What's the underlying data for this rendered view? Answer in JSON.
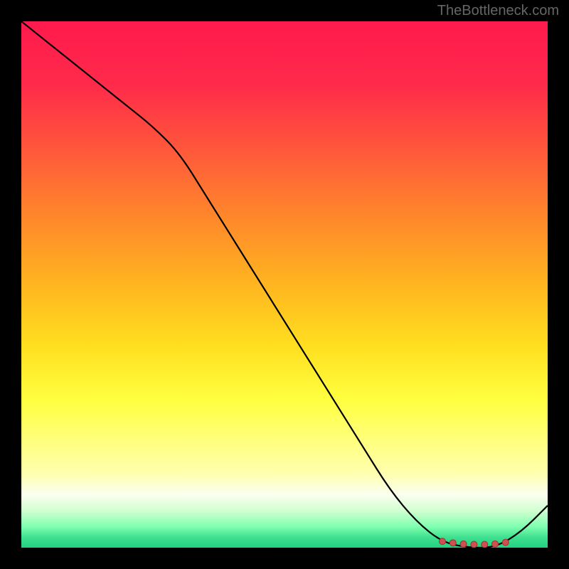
{
  "watermark": "TheBottleneck.com",
  "chart_data": {
    "type": "line",
    "title": "",
    "xlabel": "",
    "ylabel": "",
    "xlim": [
      0,
      100
    ],
    "ylim": [
      0,
      100
    ],
    "x": [
      0,
      5,
      10,
      15,
      20,
      25,
      30,
      35,
      40,
      45,
      50,
      55,
      60,
      65,
      70,
      75,
      80,
      85,
      90,
      95,
      100
    ],
    "values": [
      100,
      96,
      92,
      88,
      84,
      80,
      75,
      67,
      59,
      51,
      43,
      35,
      27,
      19,
      11,
      5,
      1,
      0,
      0,
      3,
      8
    ],
    "markers": {
      "x": [
        80,
        82,
        84,
        86,
        88,
        90,
        92
      ],
      "y": [
        1.2,
        0.9,
        0.7,
        0.6,
        0.6,
        0.7,
        1.0
      ]
    },
    "gradient_stops": [
      {
        "offset": 0,
        "color": "#ff1a4d"
      },
      {
        "offset": 12,
        "color": "#ff2a4a"
      },
      {
        "offset": 25,
        "color": "#ff5a3a"
      },
      {
        "offset": 38,
        "color": "#ff8a2a"
      },
      {
        "offset": 50,
        "color": "#ffb520"
      },
      {
        "offset": 62,
        "color": "#ffe020"
      },
      {
        "offset": 72,
        "color": "#ffff40"
      },
      {
        "offset": 80,
        "color": "#ffff80"
      },
      {
        "offset": 86,
        "color": "#ffffb0"
      },
      {
        "offset": 90,
        "color": "#fafff0"
      },
      {
        "offset": 93,
        "color": "#d0ffd0"
      },
      {
        "offset": 96,
        "color": "#80ffb0"
      },
      {
        "offset": 98,
        "color": "#40e090"
      },
      {
        "offset": 100,
        "color": "#20d080"
      }
    ]
  }
}
